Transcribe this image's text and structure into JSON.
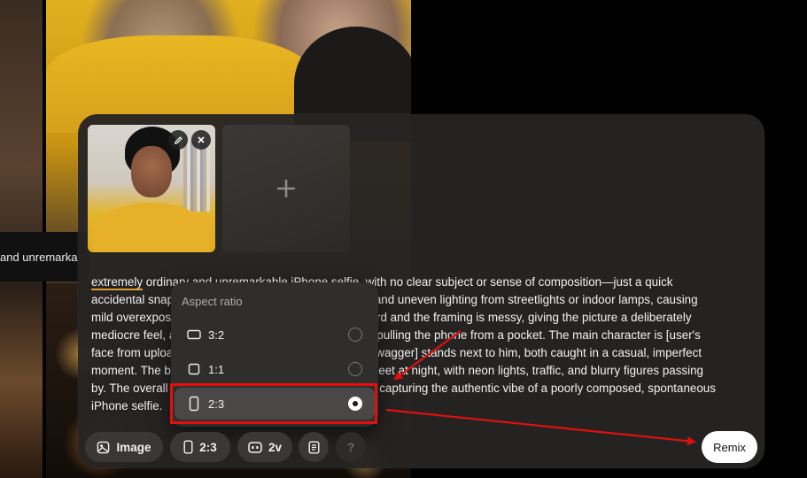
{
  "background": {
    "strip_text": "and unremarka"
  },
  "reference_images": {
    "edit_icon": "pencil-icon",
    "remove_icon": "close-icon",
    "add_slot_icon": "plus-icon"
  },
  "prompt": {
    "highlight_word": "extremely",
    "text_line1": " ordinary and unremarkable iPhone selfie, with no clear subject or sense of composition—just a quick",
    "text_rest": "accidental snapshot. The photo has slight motion blur and uneven lighting from streetlights or indoor lamps, causing\nmild overexposure in some areas. The angle is awkward and the framing is messy, giving the picture a deliberately\nmediocre feel, as if it was taken absentmindedly while pulling the phone from a pocket. The main character is [user's\nface from upload], and [another character like Taylor Swagger] stands next to him, both caught in a casual, imperfect\nmoment. The background shows a lively Manhattan street at night, with neon lights, traffic, and blurry figures passing\nby. The overall effect is intentionally plain and random, capturing the authentic vibe of a poorly composed, spontaneous\niPhone selfie."
  },
  "aspect_menu": {
    "title": "Aspect ratio",
    "options": [
      {
        "label": "3:2",
        "icon": "landscape-ratio-icon",
        "selected": false
      },
      {
        "label": "1:1",
        "icon": "square-ratio-icon",
        "selected": false
      },
      {
        "label": "2:3",
        "icon": "portrait-ratio-icon",
        "selected": true
      }
    ]
  },
  "toolbar": {
    "image_label": "Image",
    "ratio_label": "2:3",
    "variations_label": "2v",
    "help_label": "?",
    "remix_label": "Remix"
  },
  "annotation_color": "#e30f0f"
}
